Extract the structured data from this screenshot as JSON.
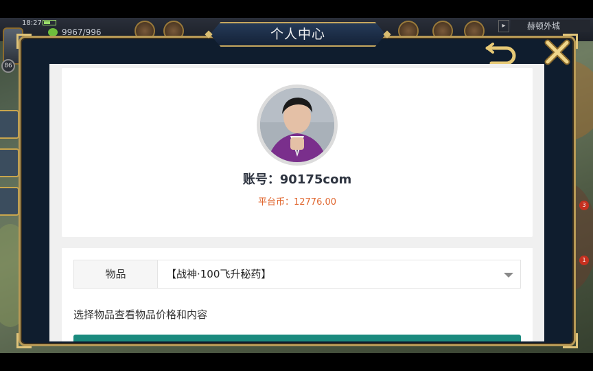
{
  "status_bar": {
    "time": "18:27",
    "gold": "9967/996"
  },
  "hud": {
    "level": "86",
    "location": "赫顿外城",
    "badges": [
      "3",
      "1"
    ]
  },
  "dialog": {
    "title": "个人中心"
  },
  "profile": {
    "account_label": "账号：",
    "account_id": "90175com",
    "coins_label": "平台币：",
    "coins_value": "12776.00"
  },
  "item": {
    "label": "物品",
    "selected": "【战神·100飞升秘药】",
    "hint": "选择物品查看物品价格和内容"
  },
  "icons": {
    "back": "back-arrow-icon",
    "close": "close-x-icon",
    "dropdown": "chevron-down-icon"
  },
  "colors": {
    "frame_gold": "#b89a56",
    "dialog_bg": "#0f1d2e",
    "coins_orange": "#e0662e",
    "button_teal": "#1a8a7e"
  }
}
